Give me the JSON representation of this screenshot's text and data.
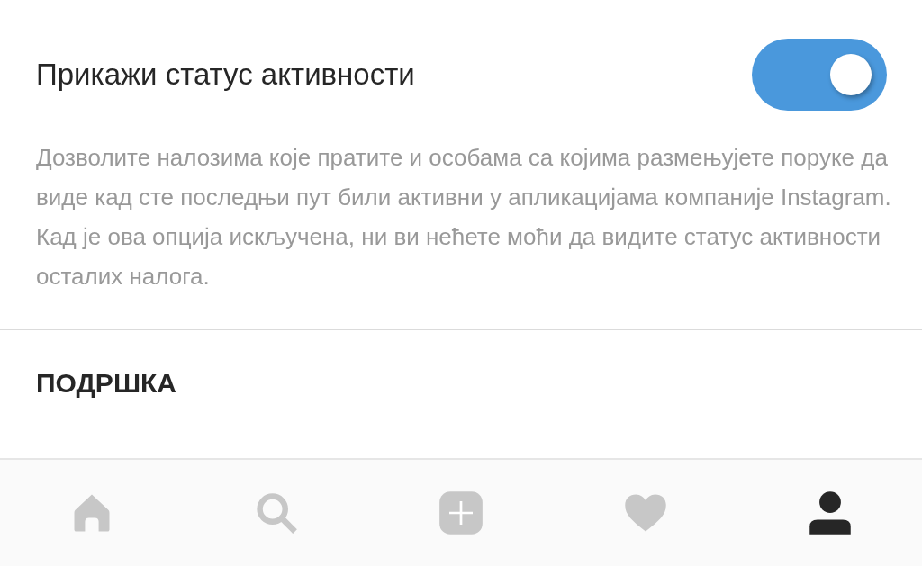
{
  "setting": {
    "title": "Прикажи статус активности",
    "on": true,
    "description": "Дозволите налозима које пратите и особама са којима размењујете поруке да виде кад сте последњи пут били активни у апликацијама компаније Instagram. Кад је ова опција искључена, ни ви нећете моћи да видите статус активности осталих налога."
  },
  "section": {
    "title": "ПОДРШКА"
  },
  "nav": [
    {
      "kind": "home",
      "selected": false
    },
    {
      "kind": "search",
      "selected": false
    },
    {
      "kind": "add",
      "selected": false
    },
    {
      "kind": "heart",
      "selected": false
    },
    {
      "kind": "profile",
      "selected": true
    }
  ]
}
